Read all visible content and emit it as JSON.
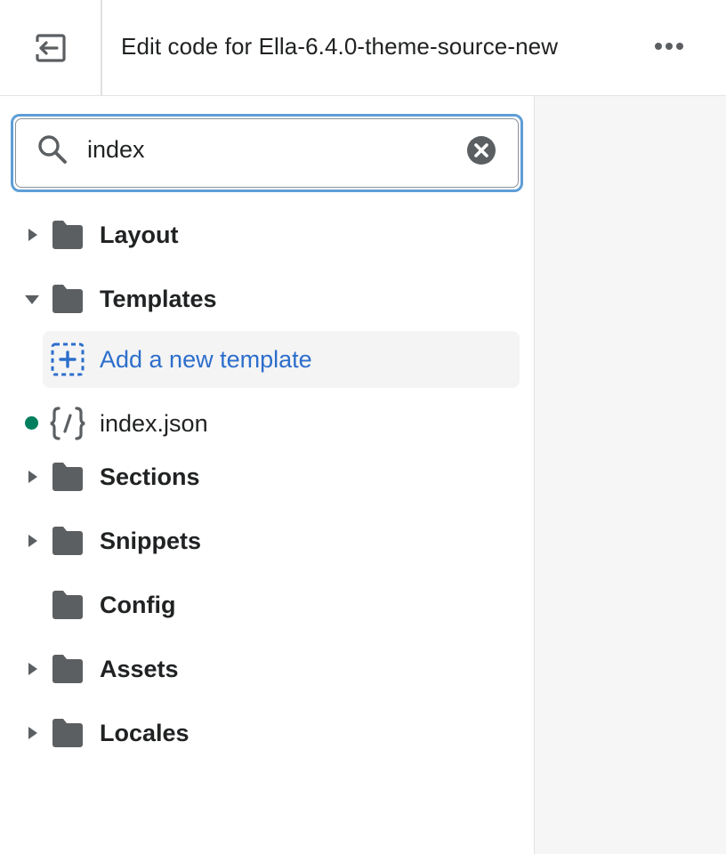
{
  "header": {
    "title": "Edit code for Ella-6.4.0-theme-source-new",
    "exit_icon": "exit-icon",
    "more_icon": "horizontal-dots-icon"
  },
  "search": {
    "value": "index",
    "placeholder": "",
    "search_icon": "search-icon",
    "clear_icon": "circle-x-icon"
  },
  "tree": {
    "layout": {
      "label": "Layout",
      "expanded": false
    },
    "templates": {
      "label": "Templates",
      "expanded": true
    },
    "add_template": {
      "label": "Add a new template",
      "icon": "dashed-plus-icon"
    },
    "index_file": {
      "label": "index.json",
      "icon": "code-json-icon",
      "modified": true
    },
    "sections": {
      "label": "Sections",
      "expanded": false
    },
    "snippets": {
      "label": "Snippets",
      "expanded": false
    },
    "config": {
      "label": "Config"
    },
    "assets": {
      "label": "Assets",
      "expanded": false
    },
    "locales": {
      "label": "Locales",
      "expanded": false
    }
  },
  "colors": {
    "accent": "#2c6ecb",
    "focus_ring": "#5e9ed6",
    "folder": "#5c5f62",
    "modified_dot": "#007f5f"
  }
}
